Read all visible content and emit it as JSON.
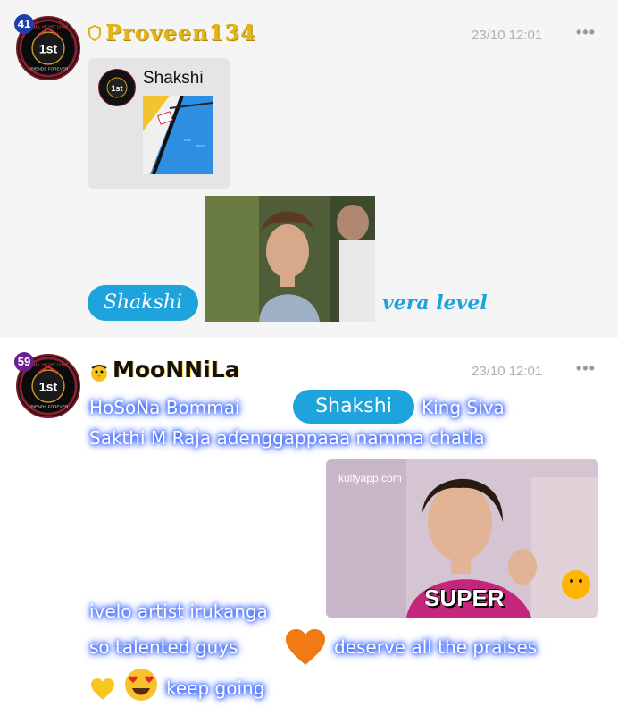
{
  "messages": [
    {
      "level": "41",
      "level_color": "#1f3fae",
      "username": "Proveen134",
      "username_color": "#e4b414",
      "time": "23/10 12:01",
      "more": "•••",
      "avatar_text": {
        "top": "TAMIL HEART CHAT",
        "center": "1st",
        "bottom": "FRIENDS FOREVER"
      },
      "card": {
        "name": "Shakshi"
      },
      "mention": "Shakshi",
      "trailing_text": "vera level"
    },
    {
      "level": "59",
      "level_color": "#6a1f8f",
      "username": "MooNNiLa",
      "time": "23/10 12:01",
      "more": "•••",
      "avatar_text": {
        "top": "TAMIL HEART CHAT",
        "center": "1st",
        "bottom": "FRIENDS FOREVER"
      },
      "line1_a": "HoSoNa Bommai",
      "mention": "Shakshi",
      "line1_b": "King Siva",
      "line2": "Sakthi M Raja adenggappaaa namma chatla",
      "gif_watermark": "kulfyapp.com",
      "gif_caption": "SUPER",
      "line3": "ivelo artist irukanga",
      "line4_a": "so talented guys",
      "line4_b": "deserve all the praises",
      "line5": "keep going"
    }
  ],
  "colors": {
    "accent": "#1fa3dc",
    "glow": "#1a4bff",
    "time": "#b0b0b0"
  }
}
